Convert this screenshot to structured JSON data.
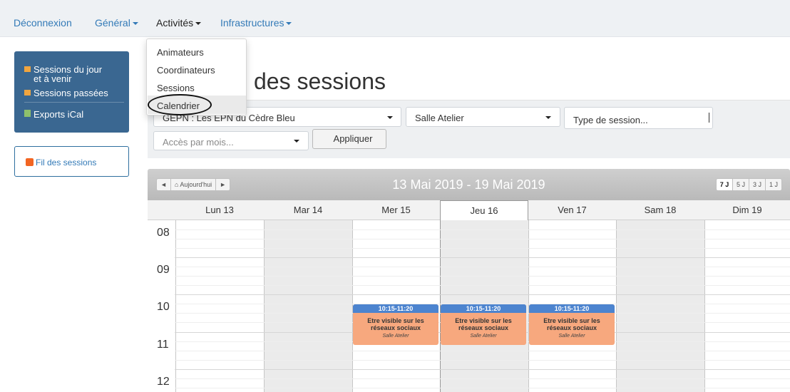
{
  "nav": {
    "logout": "Déconnexion",
    "general": "Général",
    "activities": "Activités",
    "infrastructures": "Infrastructures"
  },
  "dropdown": {
    "items": [
      "Animateurs",
      "Coordinateurs",
      "Sessions",
      "Calendrier"
    ]
  },
  "sidebar": {
    "sessions_today": "Sessions du jour",
    "sessions_today_2": "et à venir",
    "sessions_past": "Sessions passées",
    "exports": "Exports iCal",
    "feed": "Fil des sessions"
  },
  "page": {
    "title": "des sessions"
  },
  "filters": {
    "epn": "GEPN : Les EPN du Cèdre Bleu",
    "room": "Salle Atelier",
    "type_placeholder": "Type de session...",
    "month_placeholder": "Accès par mois...",
    "apply": "Appliquer"
  },
  "calendar": {
    "prev": "◄",
    "today": "Aujourd'hui",
    "next": "►",
    "range": "13 Mai 2019 - 19 Mai 2019",
    "views": [
      "7 J",
      "5 J",
      "3 J",
      "1 J"
    ],
    "days": [
      "Lun 13",
      "Mar 14",
      "Mer 15",
      "Jeu 16",
      "Ven 17",
      "Sam 18",
      "Dim 19"
    ],
    "hours": [
      "08",
      "09",
      "10",
      "11",
      "12"
    ],
    "events": [
      {
        "time": "10:15-11:20",
        "title": "Etre visible sur les réseaux sociaux",
        "room": "Salle Atelier"
      },
      {
        "time": "10:15-11:20",
        "title": "Etre visible sur les réseaux sociaux",
        "room": "Salle Atelier"
      },
      {
        "time": "10:15-11:20",
        "title": "Etre visible sur les réseaux sociaux",
        "room": "Salle Atelier"
      }
    ]
  },
  "colors": {
    "navbar": "#eef1f4",
    "sidebar": "#3a6791",
    "event_header": "#4c84cf",
    "event_body": "#f7a87e"
  }
}
